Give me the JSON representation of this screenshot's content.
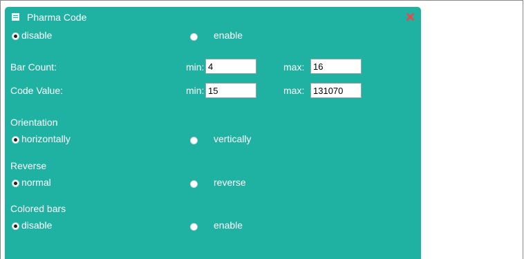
{
  "panel": {
    "title": "Pharma Code",
    "icons": {
      "title": "panel-icon",
      "close": "close-icon"
    },
    "colors": {
      "background": "#1fb2a2",
      "text": "#ffffff",
      "close": "#e34a4a"
    }
  },
  "mode": {
    "disable_label": "disable",
    "enable_label": "enable",
    "selected": "disable"
  },
  "bar_count": {
    "label": "Bar Count:",
    "min_label": "min:",
    "min_value": "4",
    "max_label": "max:",
    "max_value": "16"
  },
  "code_value": {
    "label": "Code Value:",
    "min_label": "min:",
    "min_value": "15",
    "max_label": "max:",
    "max_value": "131070"
  },
  "orientation": {
    "heading": "Orientation",
    "option_a": "horizontally",
    "option_b": "vertically",
    "selected": "horizontally"
  },
  "reverse": {
    "heading": "Reverse",
    "option_a": "normal",
    "option_b": "reverse",
    "selected": "normal"
  },
  "colored_bars": {
    "heading": "Colored bars",
    "option_a": "disable",
    "option_b": "enable",
    "selected": "disable"
  }
}
